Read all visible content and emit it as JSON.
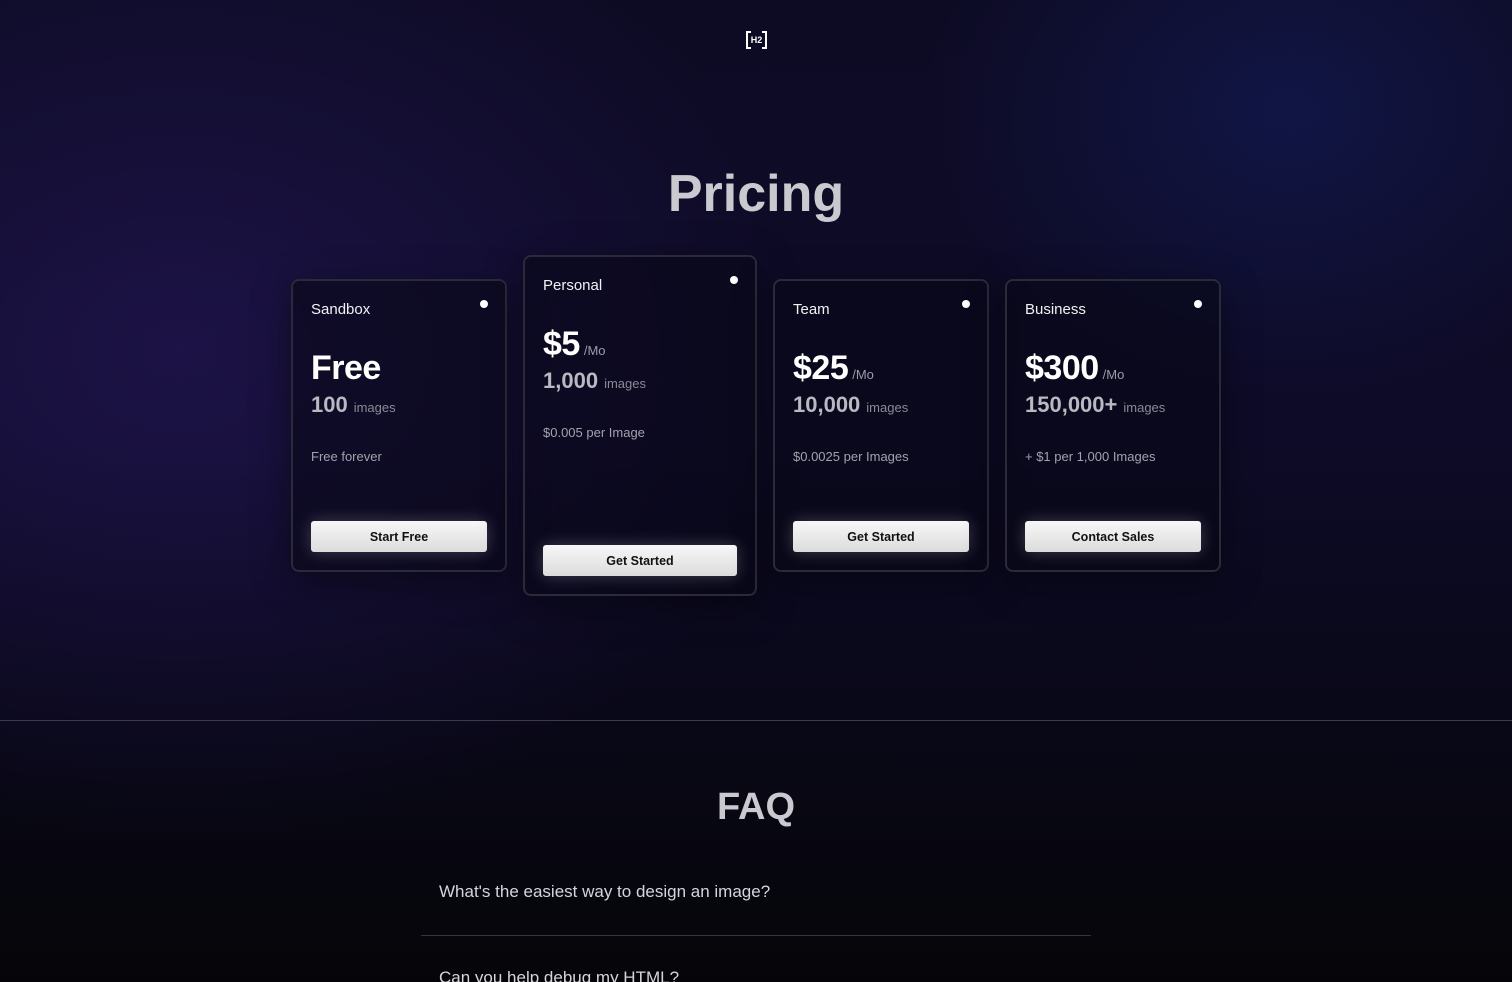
{
  "logo": {
    "text": "H2"
  },
  "pricing": {
    "title": "Pricing",
    "plans": [
      {
        "name": "Sandbox",
        "price": "Free",
        "per": "",
        "quantity": "100",
        "unit": "images",
        "note": "Free forever",
        "cta": "Start Free",
        "featured": false
      },
      {
        "name": "Personal",
        "price": "$5",
        "per": "/Mo",
        "quantity": "1,000",
        "unit": "images",
        "note": "$0.005 per Image",
        "cta": "Get Started",
        "featured": true
      },
      {
        "name": "Team",
        "price": "$25",
        "per": "/Mo",
        "quantity": "10,000",
        "unit": "images",
        "note": "$0.0025 per Images",
        "cta": "Get Started",
        "featured": false
      },
      {
        "name": "Business",
        "price": "$300",
        "per": "/Mo",
        "quantity": "150,000+",
        "unit": "images",
        "note": "+ $1 per 1,000 Images",
        "cta": "Contact Sales",
        "featured": false
      }
    ]
  },
  "faq": {
    "title": "FAQ",
    "items": [
      {
        "question": "What's the easiest way to design an image?"
      },
      {
        "question": "Can you help debug my HTML?"
      }
    ]
  }
}
